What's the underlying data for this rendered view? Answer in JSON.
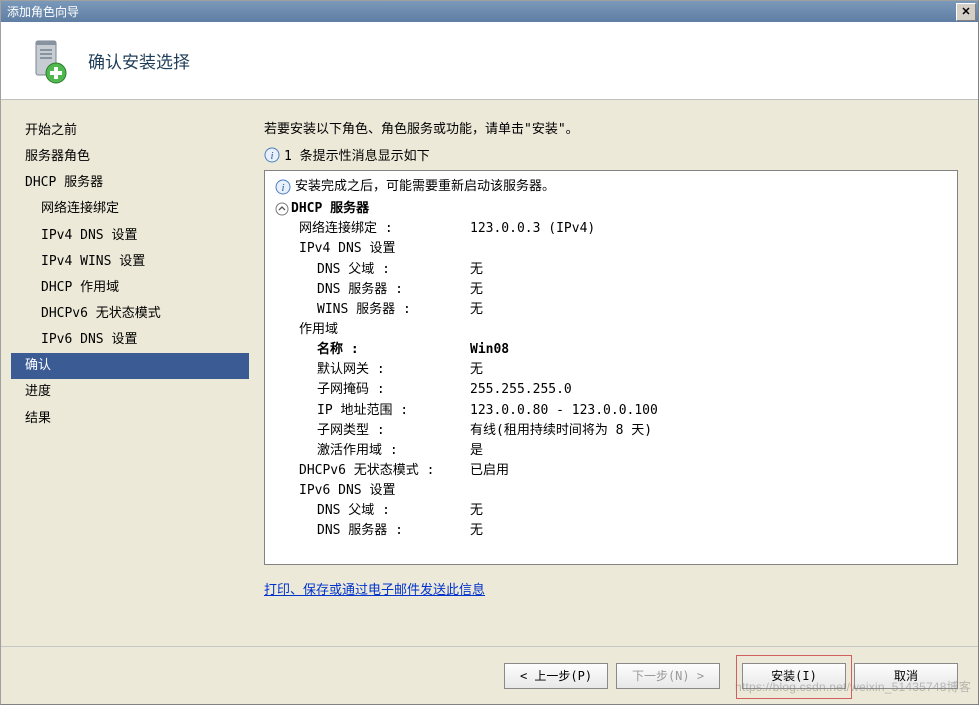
{
  "window": {
    "title": "添加角色向导",
    "close_label": "✕"
  },
  "header": {
    "title": "确认安装选择"
  },
  "sidebar": {
    "items": [
      {
        "label": "开始之前",
        "child": false,
        "selected": false
      },
      {
        "label": "服务器角色",
        "child": false,
        "selected": false
      },
      {
        "label": "DHCP 服务器",
        "child": false,
        "selected": false
      },
      {
        "label": "网络连接绑定",
        "child": true,
        "selected": false
      },
      {
        "label": "IPv4 DNS 设置",
        "child": true,
        "selected": false
      },
      {
        "label": "IPv4 WINS 设置",
        "child": true,
        "selected": false
      },
      {
        "label": "DHCP 作用域",
        "child": true,
        "selected": false
      },
      {
        "label": "DHCPv6 无状态模式",
        "child": true,
        "selected": false
      },
      {
        "label": "IPv6 DNS 设置",
        "child": true,
        "selected": false
      },
      {
        "label": "确认",
        "child": false,
        "selected": true
      },
      {
        "label": "进度",
        "child": false,
        "selected": false
      },
      {
        "label": "结果",
        "child": false,
        "selected": false
      }
    ]
  },
  "content": {
    "intro": "若要安装以下角色、角色服务或功能，请单击\"安装\"。",
    "info_line": "1 条提示性消息显示如下",
    "warn_line": "安装完成之后，可能需要重新启动该服务器。",
    "section_title": "DHCP 服务器",
    "rows": [
      {
        "indent": 1,
        "label": "网络连接绑定 :",
        "value": "123.0.0.3 (IPv4)"
      },
      {
        "indent": 1,
        "label": "IPv4 DNS 设置",
        "value": ""
      },
      {
        "indent": 2,
        "label": "DNS 父域 :",
        "value": "无"
      },
      {
        "indent": 2,
        "label": "DNS 服务器 :",
        "value": "无"
      },
      {
        "indent": 2,
        "label": "WINS 服务器 :",
        "value": "无"
      },
      {
        "indent": 1,
        "label": "作用域",
        "value": ""
      },
      {
        "indent": 2,
        "label": "名称 :",
        "bold": true,
        "value": "Win08",
        "vbold": true
      },
      {
        "indent": 2,
        "label": "默认网关 :",
        "value": "无"
      },
      {
        "indent": 2,
        "label": "子网掩码 :",
        "value": "255.255.255.0"
      },
      {
        "indent": 2,
        "label": "IP 地址范围 :",
        "value": "123.0.0.80 - 123.0.0.100"
      },
      {
        "indent": 2,
        "label": "子网类型 :",
        "value": "有线(租用持续时间将为 8 天)"
      },
      {
        "indent": 2,
        "label": "激活作用域 :",
        "value": "是"
      },
      {
        "indent": 1,
        "label": "DHCPv6 无状态模式 :",
        "value": "已启用"
      },
      {
        "indent": 1,
        "label": "IPv6 DNS 设置",
        "value": ""
      },
      {
        "indent": 2,
        "label": "DNS 父域 :",
        "value": "无"
      },
      {
        "indent": 2,
        "label": "DNS 服务器 :",
        "value": "无"
      }
    ],
    "link": "打印、保存或通过电子邮件发送此信息"
  },
  "buttons": {
    "back": "< 上一步(P)",
    "next": "下一步(N) >",
    "install": "安装(I)",
    "cancel": "取消"
  },
  "watermark": "https://blog.csdn.net/weixin_51435748博客"
}
